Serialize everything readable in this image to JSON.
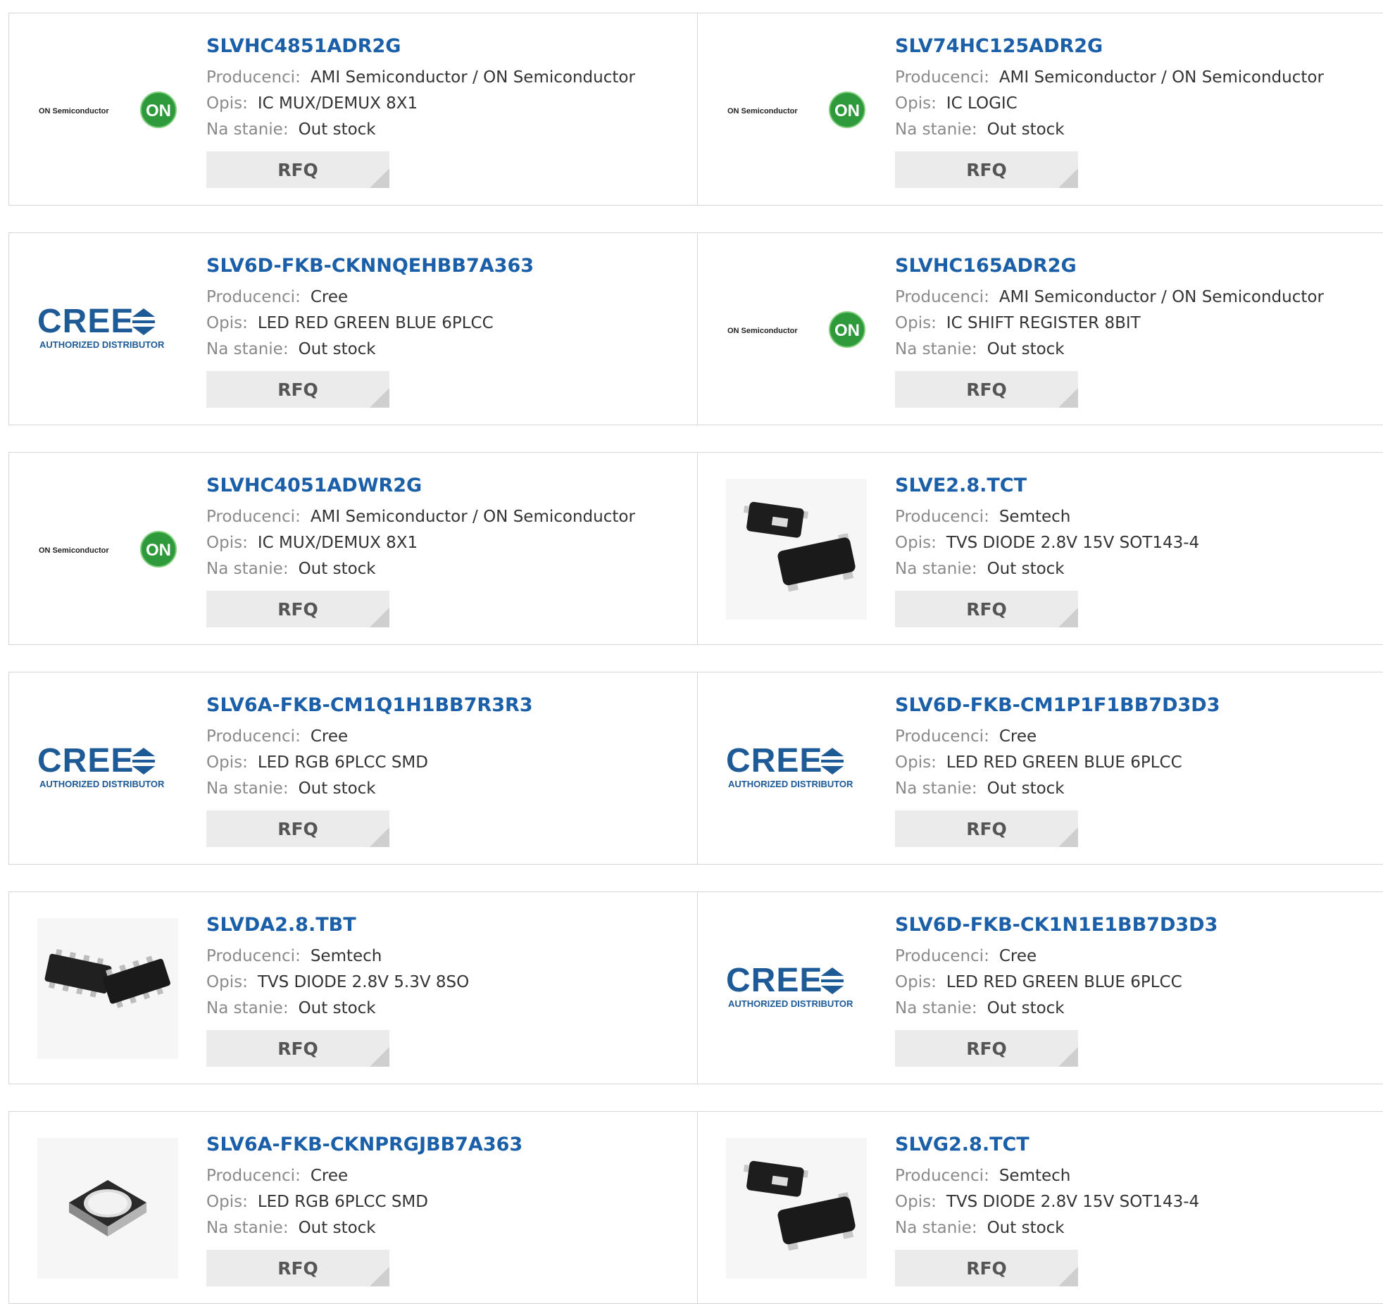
{
  "labels": {
    "manufacturer": "Producenci:",
    "description": "Opis:",
    "stock": "Na stanie:",
    "rfq": "RFQ"
  },
  "logos": {
    "on_text": "ON Semiconductor",
    "on_mark": "ON",
    "cree_text": "CREE",
    "cree_sub": "AUTHORIZED DISTRIBUTOR"
  },
  "colors": {
    "link": "#1a5fa8",
    "cree_blue": "#1d5a96",
    "on_green": "#2e9a3c",
    "rfq_bg": "#ebebeb"
  },
  "products": [
    {
      "part": "SLVHC4851ADR2G",
      "manufacturer": "AMI Semiconductor / ON Semiconductor",
      "description": "IC MUX/DEMUX 8X1",
      "stock": "Out stock",
      "image": "on-semiconductor-logo"
    },
    {
      "part": "SLV74HC125ADR2G",
      "manufacturer": "AMI Semiconductor / ON Semiconductor",
      "description": "IC LOGIC",
      "stock": "Out stock",
      "image": "on-semiconductor-logo"
    },
    {
      "part": "SLV6D-FKB-CKNNQEHBB7A363",
      "manufacturer": "Cree",
      "description": "LED RED GREEN BLUE 6PLCC",
      "stock": "Out stock",
      "image": "cree-logo"
    },
    {
      "part": "SLVHC165ADR2G",
      "manufacturer": "AMI Semiconductor / ON Semiconductor",
      "description": "IC SHIFT REGISTER 8BIT",
      "stock": "Out stock",
      "image": "on-semiconductor-logo"
    },
    {
      "part": "SLVHC4051ADWR2G",
      "manufacturer": "AMI Semiconductor / ON Semiconductor",
      "description": "IC MUX/DEMUX 8X1",
      "stock": "Out stock",
      "image": "on-semiconductor-logo"
    },
    {
      "part": "SLVE2.8.TCT",
      "manufacturer": "Semtech",
      "description": "TVS DIODE 2.8V 15V SOT143-4",
      "stock": "Out stock",
      "image": "sot143-package"
    },
    {
      "part": "SLV6A-FKB-CM1Q1H1BB7R3R3",
      "manufacturer": "Cree",
      "description": "LED RGB 6PLCC SMD",
      "stock": "Out stock",
      "image": "cree-logo"
    },
    {
      "part": "SLV6D-FKB-CM1P1F1BB7D3D3",
      "manufacturer": "Cree",
      "description": "LED RED GREEN BLUE 6PLCC",
      "stock": "Out stock",
      "image": "cree-logo"
    },
    {
      "part": "SLVDA2.8.TBT",
      "manufacturer": "Semtech",
      "description": "TVS DIODE 2.8V 5.3V 8SO",
      "stock": "Out stock",
      "image": "so8-package"
    },
    {
      "part": "SLV6D-FKB-CK1N1E1BB7D3D3",
      "manufacturer": "Cree",
      "description": "LED RED GREEN BLUE 6PLCC",
      "stock": "Out stock",
      "image": "cree-logo"
    },
    {
      "part": "SLV6A-FKB-CKNPRGJBB7A363",
      "manufacturer": "Cree",
      "description": "LED RGB 6PLCC SMD",
      "stock": "Out stock",
      "image": "plcc-led"
    },
    {
      "part": "SLVG2.8.TCT",
      "manufacturer": "Semtech",
      "description": "TVS DIODE 2.8V 15V SOT143-4",
      "stock": "Out stock",
      "image": "sot143-package"
    }
  ]
}
